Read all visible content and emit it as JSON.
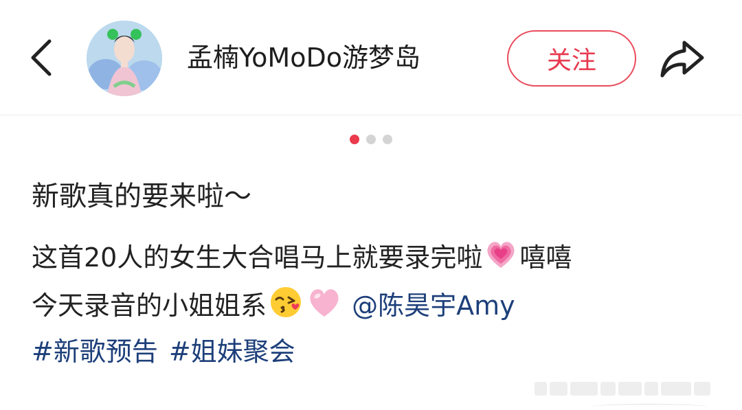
{
  "header": {
    "back_icon": "chevron-left-icon",
    "username": "孟楠YoMoDo游梦岛",
    "follow_label": "关注",
    "share_icon": "share-arrow-icon",
    "accent_color": "#e83a4f"
  },
  "carousel": {
    "total": 3,
    "active_index": 0
  },
  "post": {
    "title": "新歌真的要来啦～",
    "line1_text": "这首20人的女生大合唱马上就要录完啦",
    "line1_emoji": "growing-pink-heart-emoji",
    "line1_tail": "嘻嘻",
    "line2_text": "今天录音的小姐姐系",
    "line2_emojis": [
      "kissing-face-emoji",
      "pink-heart-emoji"
    ],
    "mention": "@陈昊宇Amy",
    "hashtags": [
      "#新歌预告",
      "#姐妹聚会"
    ],
    "link_color": "#1d3f7a"
  }
}
